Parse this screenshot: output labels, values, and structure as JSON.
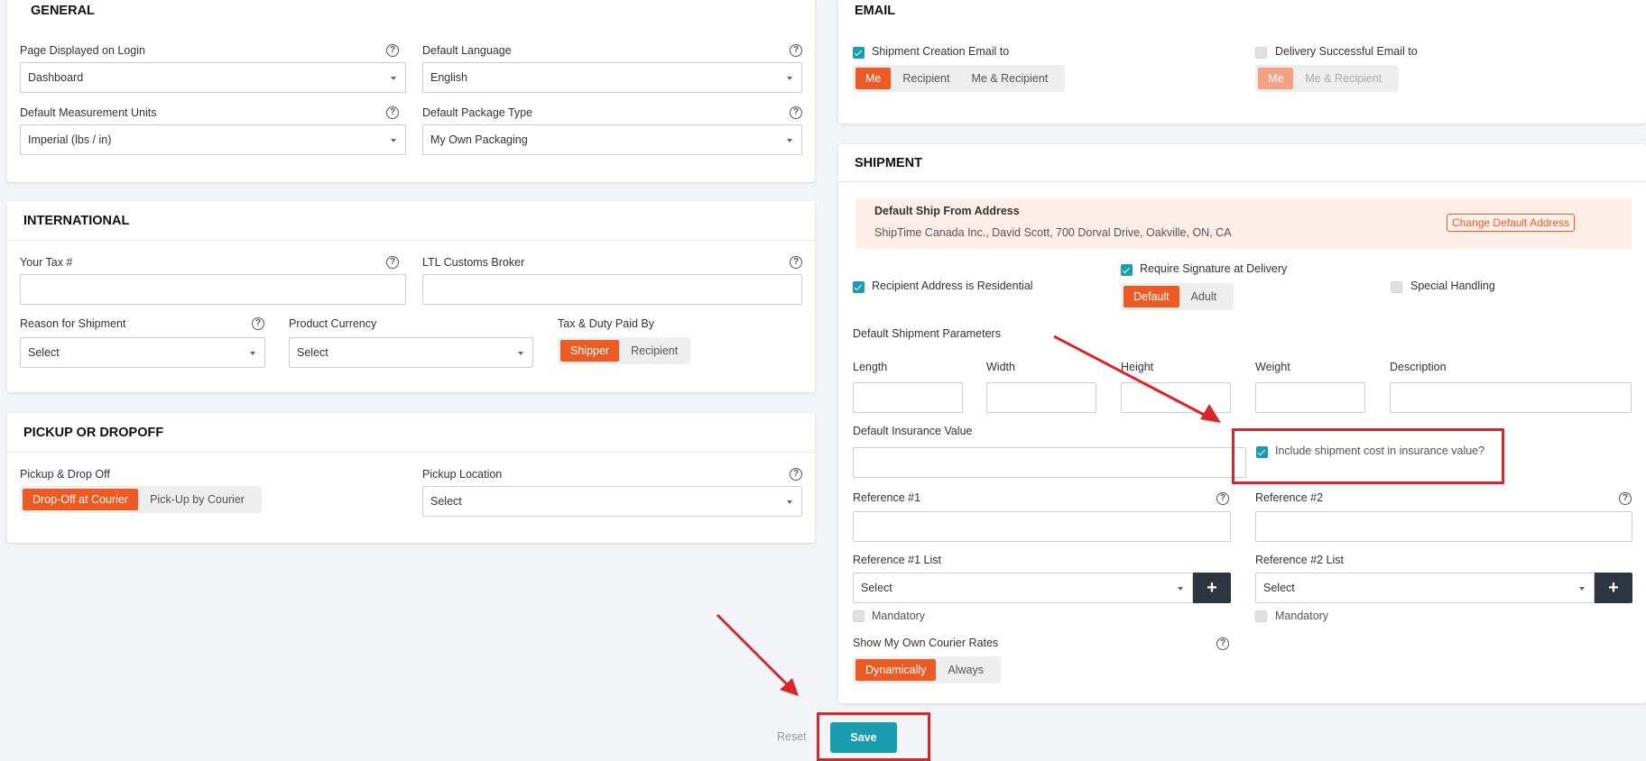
{
  "general": {
    "title": "GENERAL",
    "page_login_label": "Page Displayed on Login",
    "page_login_value": "Dashboard",
    "language_label": "Default Language",
    "language_value": "English",
    "units_label": "Default Measurement Units",
    "units_value": "Imperial (lbs / in)",
    "package_label": "Default Package Type",
    "package_value": "My Own Packaging"
  },
  "international": {
    "title": "INTERNATIONAL",
    "tax_label": "Your Tax #",
    "broker_label": "LTL Customs Broker",
    "reason_label": "Reason for Shipment",
    "reason_value": "Select",
    "currency_label": "Product Currency",
    "currency_value": "Select",
    "duty_label": "Tax & Duty Paid By",
    "duty_options": [
      "Shipper",
      "Recipient"
    ]
  },
  "pickup": {
    "title": "PICKUP OR DROPOFF",
    "pickdrop_label": "Pickup & Drop Off",
    "pickdrop_options": [
      "Drop-Off at Courier",
      "Pick-Up by Courier"
    ],
    "location_label": "Pickup Location",
    "location_value": "Select"
  },
  "email": {
    "title": "EMAIL",
    "creation_label": "Shipment Creation Email to",
    "creation_options": [
      "Me",
      "Recipient",
      "Me & Recipient"
    ],
    "delivery_label": "Delivery Successful Email to",
    "delivery_options": [
      "Me",
      "Me & Recipient"
    ]
  },
  "shipment": {
    "title": "SHIPMENT",
    "ship_from_title": "Default Ship From Address",
    "ship_from_address": "ShipTime Canada Inc., David Scott, 700 Dorval Drive, Oakville, ON, CA",
    "change_address": "Change Default Address",
    "residential_label": "Recipient Address is Residential",
    "signature_label": "Require Signature at Delivery",
    "signature_options": [
      "Default",
      "Adult"
    ],
    "special_label": "Special Handling",
    "params_label": "Default Shipment Parameters",
    "length_label": "Length",
    "width_label": "Width",
    "height_label": "Height",
    "weight_label": "Weight",
    "description_label": "Description",
    "insurance_label": "Default Insurance Value",
    "include_cost_label": "Include shipment cost in insurance value?",
    "ref1_label": "Reference #1",
    "ref2_label": "Reference #2",
    "ref1_list_label": "Reference #1 List",
    "ref1_list_value": "Select",
    "ref2_list_label": "Reference #2 List",
    "ref2_list_value": "Select",
    "mandatory1": "Mandatory",
    "mandatory2": "Mandatory",
    "courier_rates_label": "Show My Own Courier Rates",
    "courier_rates_options": [
      "Dynamically",
      "Always"
    ]
  },
  "footer": {
    "reset": "Reset",
    "save": "Save"
  },
  "colors": {
    "accent_orange": "#ee5a24",
    "accent_teal": "#1a9cb0",
    "annotation_red": "#d8262b"
  }
}
